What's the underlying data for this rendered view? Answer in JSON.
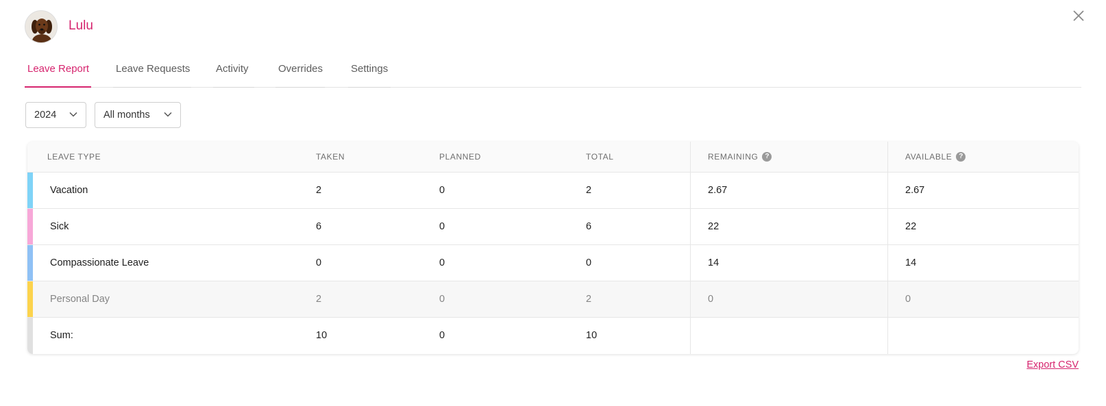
{
  "user": {
    "name": "Lulu"
  },
  "tabs": [
    {
      "label": "Leave Report",
      "active": true
    },
    {
      "label": "Leave Requests",
      "active": false
    },
    {
      "label": "Activity",
      "active": false
    },
    {
      "label": "Overrides",
      "active": false
    },
    {
      "label": "Settings",
      "active": false
    }
  ],
  "filters": {
    "year": "2024",
    "months": "All months"
  },
  "table": {
    "headers": {
      "leave_type": "LEAVE TYPE",
      "taken": "TAKEN",
      "planned": "PLANNED",
      "total": "TOTAL",
      "remaining": "REMAINING",
      "available": "AVAILABLE"
    },
    "rows": [
      {
        "type": "Vacation",
        "taken": "2",
        "planned": "0",
        "total": "2",
        "remaining": "2.67",
        "available": "2.67",
        "color": "#7fd3f7"
      },
      {
        "type": "Sick",
        "taken": "6",
        "planned": "0",
        "total": "6",
        "remaining": "22",
        "available": "22",
        "color": "#f7a8d8"
      },
      {
        "type": "Compassionate Leave",
        "taken": "0",
        "planned": "0",
        "total": "0",
        "remaining": "14",
        "available": "14",
        "color": "#8fc1f5"
      },
      {
        "type": "Personal Day",
        "taken": "2",
        "planned": "0",
        "total": "2",
        "remaining": "0",
        "available": "0",
        "color": "#fcd34d"
      }
    ],
    "sum": {
      "label": "Sum:",
      "taken": "10",
      "planned": "0",
      "total": "10",
      "color": "#e0e0e0"
    }
  },
  "export_label": "Export CSV",
  "colors": {
    "accent": "#d6246e"
  }
}
